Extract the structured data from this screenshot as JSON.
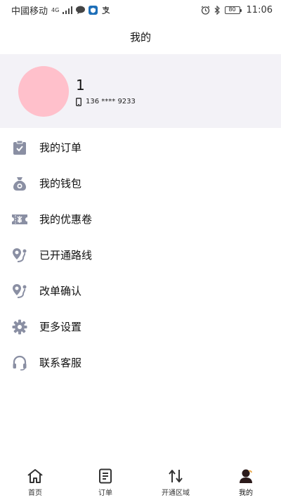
{
  "status_bar": {
    "carrier": "中國移动",
    "network": "4G",
    "battery": "80",
    "time": "11:06",
    "icons": [
      "signal-icon",
      "chat-bubble-icon",
      "app-shield-icon",
      "alipay-icon",
      "alarm-icon",
      "bluetooth-icon",
      "battery-icon"
    ]
  },
  "header": {
    "title": "我的"
  },
  "profile": {
    "name": "1",
    "phone": "136 **** 9233",
    "avatar_color": "#ffc0cb"
  },
  "menu": [
    {
      "label": "我的订单",
      "icon": "clipboard-icon"
    },
    {
      "label": "我的钱包",
      "icon": "money-bag-icon"
    },
    {
      "label": "我的优惠卷",
      "icon": "coupon-icon"
    },
    {
      "label": "已开通路线",
      "icon": "route-pin-icon"
    },
    {
      "label": "改单确认",
      "icon": "route-pin-icon"
    },
    {
      "label": "更多设置",
      "icon": "gear-icon"
    },
    {
      "label": "联系客服",
      "icon": "headset-icon"
    }
  ],
  "tabbar": [
    {
      "label": "首页",
      "icon": "home-icon",
      "active": false
    },
    {
      "label": "订单",
      "icon": "document-icon",
      "active": false
    },
    {
      "label": "开通区域",
      "icon": "swap-arrows-icon",
      "active": false
    },
    {
      "label": "我的",
      "icon": "person-icon",
      "active": true
    }
  ],
  "colors": {
    "icon_gray": "#8a8fa3",
    "profile_bg": "#f3f2f7",
    "tab_active": "#222222"
  }
}
